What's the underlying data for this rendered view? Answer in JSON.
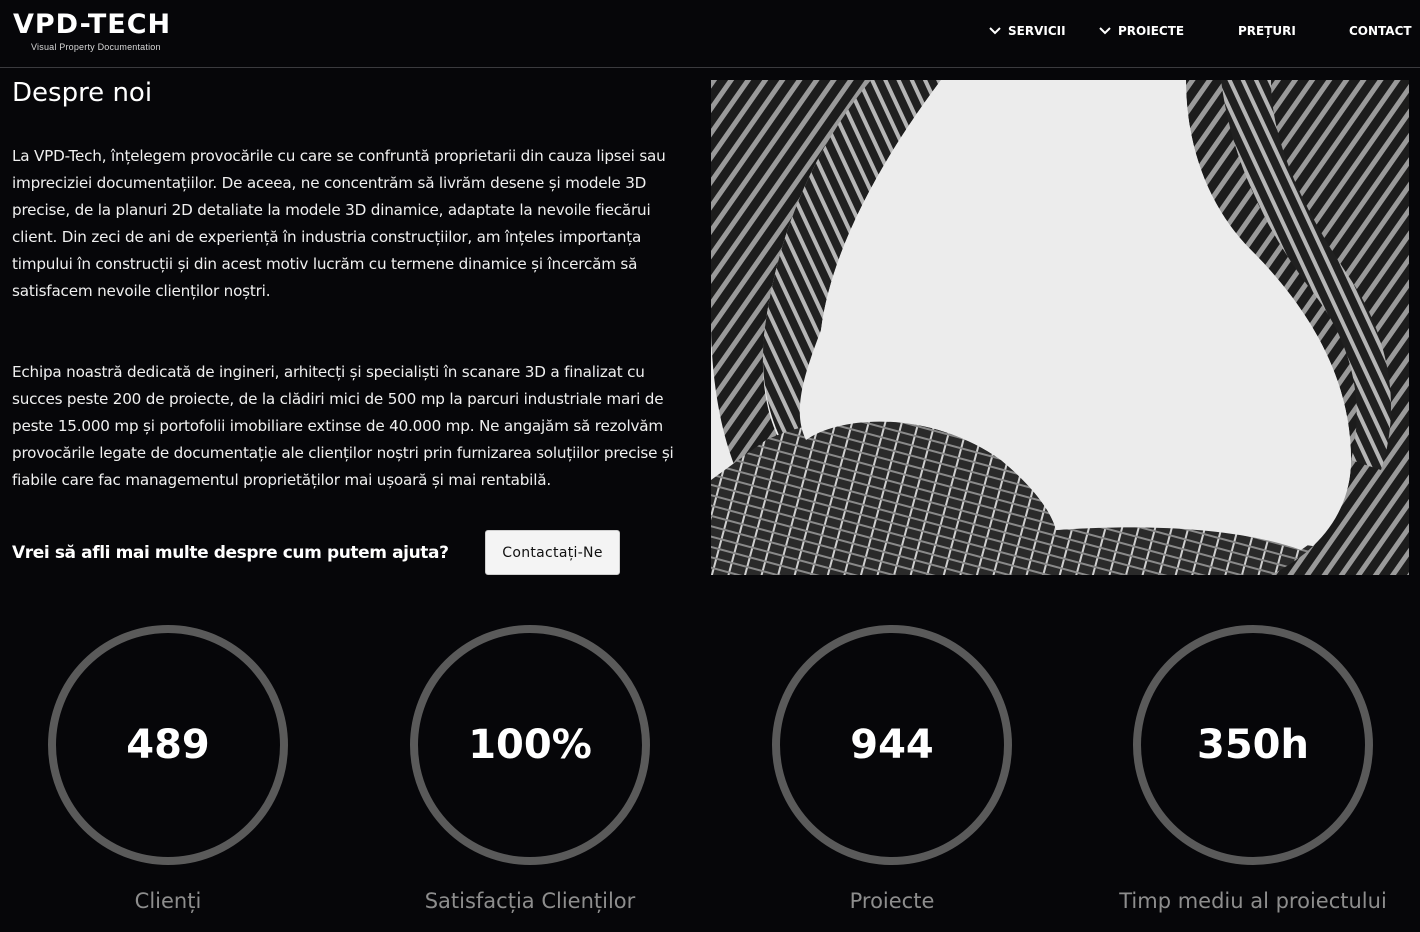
{
  "header": {
    "logo_main": "VPD-TECH",
    "logo_sub": "Visual Property Documentation",
    "nav": [
      {
        "label": "SERVICII",
        "has_dropdown": true
      },
      {
        "label": "PROIECTE",
        "has_dropdown": true
      },
      {
        "label": "PREȚURI",
        "has_dropdown": false
      },
      {
        "label": "CONTACT",
        "has_dropdown": false
      }
    ]
  },
  "about": {
    "title": "Despre noi",
    "paragraph1": "La VPD-Tech, înțelegem provocările cu care se confruntă proprietarii din cauza lipsei sau impreciziei documentațiilor. De aceea, ne concentrăm să livrăm desene și modele 3D precise, de la planuri 2D detaliate la modele 3D dinamice, adaptate la nevoile fiecărui client. Din zeci de ani de experiență în industria construcțiilor, am înțeles importanța timpului în construcții și din acest motiv lucrăm cu termene dinamice și încercăm să satisfacem nevoile clienților noștri.",
    "paragraph2": "Echipa noastră dedicată de ingineri, arhitecți și specialiști în scanare 3D a finalizat cu succes peste 200 de proiecte, de la clădiri mici de 500 mp la parcuri industriale mari de peste 15.000 mp și portofolii imobiliare extinse de 40.000 mp. Ne angajăm să rezolvăm provocările legate de documentație ale clienților noștri prin furnizarea soluțiilor precise și fiabile care fac managementul proprietăților mai ușoară și mai rentabilă.",
    "cta_text": "Vrei să afli mai multe despre cum putem ajuta?",
    "cta_button": "Contactați-Ne"
  },
  "stats": [
    {
      "value": "489",
      "label": "Clienți"
    },
    {
      "value": "100%",
      "label": "Satisfacția Clienților"
    },
    {
      "value": "944",
      "label": "Proiecte"
    },
    {
      "value": "350h",
      "label": "Timp mediu al proiectului"
    }
  ],
  "colors": {
    "background": "#060609",
    "ring": "#5a5a5a",
    "label": "#8d8d8d",
    "button_bg": "#f4f4f4"
  }
}
